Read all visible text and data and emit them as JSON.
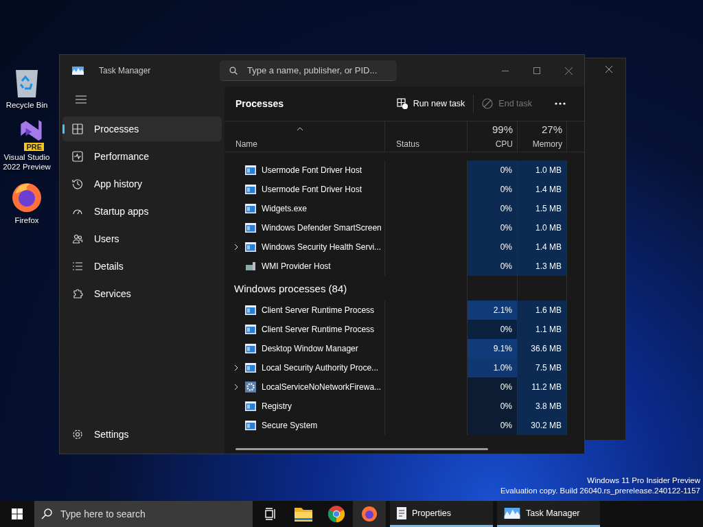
{
  "desktop_icons": [
    {
      "kind": "recycle",
      "label": "Recycle Bin"
    },
    {
      "kind": "vs",
      "label": "Visual Studio 2022 Preview",
      "badge": "PRE"
    },
    {
      "kind": "firefox",
      "label": "Firefox"
    }
  ],
  "window": {
    "title": "Task Manager",
    "search": {
      "placeholder": "Type a name, publisher, or PID..."
    }
  },
  "nav": [
    {
      "kind": "processes",
      "label": "Processes",
      "selected": true
    },
    {
      "kind": "performance",
      "label": "Performance",
      "selected": false
    },
    {
      "kind": "history",
      "label": "App history",
      "selected": false
    },
    {
      "kind": "startup",
      "label": "Startup apps",
      "selected": false
    },
    {
      "kind": "users",
      "label": "Users",
      "selected": false
    },
    {
      "kind": "details",
      "label": "Details",
      "selected": false
    },
    {
      "kind": "services",
      "label": "Services",
      "selected": false
    }
  ],
  "settings": {
    "label": "Settings"
  },
  "page_title": "Processes",
  "toolbar": [
    {
      "kind": "run",
      "label": "Run new task",
      "disabled": false
    },
    {
      "kind": "end",
      "label": "End task",
      "disabled": true
    }
  ],
  "columns": {
    "name": "Name",
    "status": "Status",
    "cpu": {
      "percent": "99%",
      "label": "CPU"
    },
    "memory": {
      "percent": "27%",
      "label": "Memory"
    }
  },
  "rows": [
    {
      "kind": "app",
      "name": "Usermode Font Driver Host",
      "expandable": false,
      "cpu": "0%",
      "color": "#0c2a52",
      "memory": "1.0 MB"
    },
    {
      "kind": "app",
      "name": "Usermode Font Driver Host",
      "expandable": false,
      "cpu": "0%",
      "color": "#0c2a52",
      "memory": "1.4 MB"
    },
    {
      "kind": "app",
      "name": "Widgets.exe",
      "expandable": false,
      "cpu": "0%",
      "color": "#0c2a52",
      "memory": "1.5 MB"
    },
    {
      "kind": "app",
      "name": "Windows Defender SmartScreen",
      "expandable": false,
      "cpu": "0%",
      "color": "#0c2a52",
      "memory": "1.0 MB"
    },
    {
      "kind": "app",
      "name": "Windows Security Health Servi...",
      "expandable": true,
      "cpu": "0%",
      "color": "#0c2a52",
      "memory": "1.4 MB"
    },
    {
      "kind": "wmi",
      "name": "WMI Provider Host",
      "expandable": false,
      "cpu": "0%",
      "color": "#0c2a52",
      "memory": "1.3 MB"
    },
    {
      "kind": "group",
      "name": "Windows processes (84)"
    },
    {
      "kind": "app",
      "name": "Client Server Runtime Process",
      "expandable": false,
      "cpu": "2.1%",
      "color": "#0f3c78",
      "memory": "1.6 MB"
    },
    {
      "kind": "app",
      "name": "Client Server Runtime Process",
      "expandable": false,
      "cpu": "0%",
      "color": "#0a213f",
      "memory": "1.1 MB"
    },
    {
      "kind": "app",
      "name": "Desktop Window Manager",
      "expandable": false,
      "cpu": "9.1%",
      "color": "#0f3c78",
      "memory": "36.6 MB"
    },
    {
      "kind": "app",
      "name": "Local Security Authority Proce...",
      "expandable": true,
      "cpu": "1.0%",
      "color": "#0f3770",
      "memory": "7.5 MB"
    },
    {
      "kind": "gear",
      "name": "LocalServiceNoNetworkFirewa...",
      "expandable": true,
      "cpu": "0%",
      "color": "#0b1c33",
      "memory": "11.2 MB"
    },
    {
      "kind": "app",
      "name": "Registry",
      "expandable": false,
      "cpu": "0%",
      "color": "#0b1c33",
      "memory": "3.8 MB"
    },
    {
      "kind": "app",
      "name": "Secure System",
      "expandable": false,
      "cpu": "0%",
      "color": "#0b1c33",
      "memory": "30.2 MB"
    }
  ],
  "watermark_os": [
    "Windows 11 Pro Insider Preview",
    "Evaluation copy. Build 26040.rs_prerelease.240122-1157"
  ],
  "taskbar": {
    "search": {
      "placeholder": "Type here to search"
    },
    "pinned": [
      {
        "kind": "taskview"
      },
      {
        "kind": "explorer"
      },
      {
        "kind": "chrome"
      },
      {
        "kind": "firefox"
      }
    ],
    "apps": [
      {
        "kind": "properties",
        "label": "Properties"
      },
      {
        "kind": "taskmanager",
        "label": "Task Manager"
      }
    ]
  }
}
